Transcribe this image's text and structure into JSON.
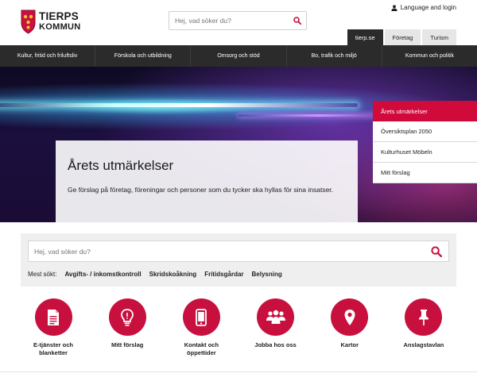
{
  "header": {
    "logo_line1": "TIERPS",
    "logo_line2": "KOMMUN",
    "search_placeholder": "Hej, vad söker du?",
    "language_label": "Language and login",
    "tabs": [
      {
        "label": "tierp.se",
        "active": true
      },
      {
        "label": "Företag",
        "active": false
      },
      {
        "label": "Turism",
        "active": false
      }
    ]
  },
  "nav": {
    "items": [
      "Kultur, fritid och friluftsliv",
      "Förskola och utbildning",
      "Omsorg och stöd",
      "Bo, trafik och miljö",
      "Kommun och politik"
    ]
  },
  "hero": {
    "title": "Årets utmärkelser",
    "text": "Ge förslag på företag, föreningar och personer som du tycker ska hyllas för sina insatser.",
    "side_menu": [
      {
        "label": "Årets utmärkelser",
        "active": true
      },
      {
        "label": "Översiktsplan 2050",
        "active": false
      },
      {
        "label": "Kulturhuset Möbeln",
        "active": false
      },
      {
        "label": "Mitt förslag",
        "active": false
      }
    ]
  },
  "search": {
    "placeholder": "Hej, vad söker du?",
    "most_searched_label": "Mest sökt:",
    "most_searched": [
      "Avgifts- / inkomstkontroll",
      "Skridskoåkning",
      "Fritidsgårdar",
      "Belysning"
    ]
  },
  "quick_links": [
    {
      "label": "E-tjänster och blanketter",
      "icon": "document-icon"
    },
    {
      "label": "Mitt förslag",
      "icon": "lightbulb-icon"
    },
    {
      "label": "Kontakt och öppettider",
      "icon": "phone-icon"
    },
    {
      "label": "Jobba hos oss",
      "icon": "people-icon"
    },
    {
      "label": "Kartor",
      "icon": "map-pin-icon"
    },
    {
      "label": "Anslagstavlan",
      "icon": "pushpin-icon"
    }
  ],
  "colors": {
    "brand_red": "#c8103e",
    "nav_dark": "#2b2b2b"
  }
}
